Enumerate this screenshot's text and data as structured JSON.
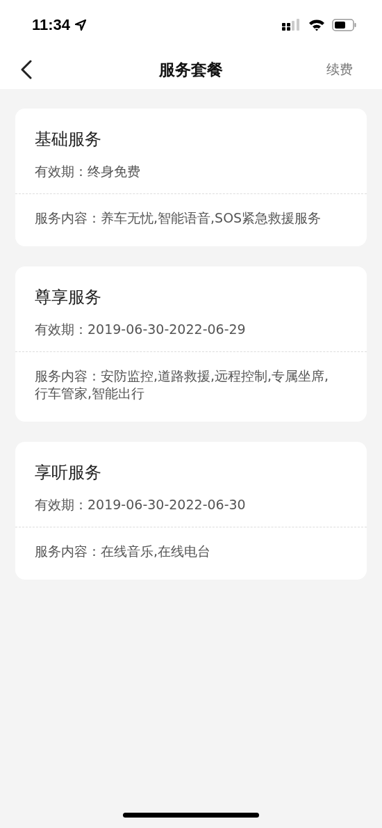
{
  "status_bar": {
    "time": "11:34"
  },
  "nav": {
    "title": "服务套餐",
    "action": "续费"
  },
  "packages": [
    {
      "name": "基础服务",
      "validity": "有效期：终身免费",
      "content": "服务内容：养车无忧,智能语音,SOS紧急救援服务"
    },
    {
      "name": "尊享服务",
      "validity": "有效期：2019-06-30-2022-06-29",
      "content": "服务内容：安防监控,道路救援,远程控制,专属坐席,行车管家,智能出行"
    },
    {
      "name": "享听服务",
      "validity": "有效期：2019-06-30-2022-06-30",
      "content": "服务内容：在线音乐,在线电台"
    }
  ]
}
